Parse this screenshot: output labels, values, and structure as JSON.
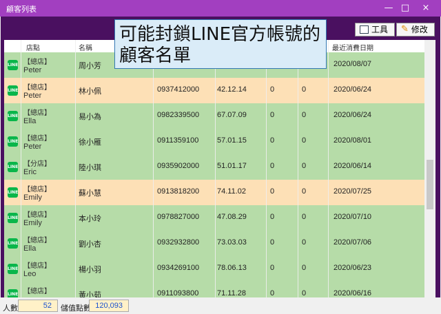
{
  "window": {
    "title": "顧客列表",
    "minimize": "—",
    "maximize": "□",
    "close": "×"
  },
  "toolbar": {
    "tools": "工具",
    "edit": "修改"
  },
  "callout": {
    "text": "可能封鎖LINE官方帳號的顧客名單"
  },
  "columns": {
    "store": "店點",
    "name": "名稱",
    "last_date": "最近消費日期"
  },
  "colors": {
    "green": "#b6dca8",
    "orange": "#fde0b6",
    "line": "#09b64a",
    "title": "#a23fc0"
  },
  "rows": [
    {
      "store": "【總店】",
      "staff": "Peter",
      "name": "周小芳",
      "phone": "",
      "birthday": "",
      "a": "",
      "b": "",
      "last": "2020/08/07",
      "tone": "green"
    },
    {
      "store": "【總店】",
      "staff": "Peter",
      "name": "林小佩",
      "phone": "0937412000",
      "birthday": "42.12.14",
      "a": "0",
      "b": "0",
      "last": "2020/06/24",
      "tone": "orange"
    },
    {
      "store": "【總店】",
      "staff": "Ella",
      "name": "易小為",
      "phone": "0982339500",
      "birthday": "67.07.09",
      "a": "0",
      "b": "0",
      "last": "2020/06/24",
      "tone": "green"
    },
    {
      "store": "【總店】",
      "staff": "Peter",
      "name": "徐小雁",
      "phone": "0911359100",
      "birthday": "57.01.15",
      "a": "0",
      "b": "0",
      "last": "2020/08/01",
      "tone": "green"
    },
    {
      "store": "【分店】",
      "staff": "Eric",
      "name": "陸小琪",
      "phone": "0935902000",
      "birthday": "51.01.17",
      "a": "0",
      "b": "0",
      "last": "2020/06/14",
      "tone": "green"
    },
    {
      "store": "【總店】",
      "staff": "Emily",
      "name": "蘇小慧",
      "phone": "0913818200",
      "birthday": "74.11.02",
      "a": "0",
      "b": "0",
      "last": "2020/07/25",
      "tone": "orange"
    },
    {
      "store": "【總店】",
      "staff": "Emily",
      "name": "本小玲",
      "phone": "0978827000",
      "birthday": "47.08.29",
      "a": "0",
      "b": "0",
      "last": "2020/07/10",
      "tone": "green"
    },
    {
      "store": "【總店】",
      "staff": "Ella",
      "name": "劉小杏",
      "phone": "0932932800",
      "birthday": "73.03.03",
      "a": "0",
      "b": "0",
      "last": "2020/07/06",
      "tone": "green"
    },
    {
      "store": "【總店】",
      "staff": "Leo",
      "name": "楊小羽",
      "phone": "0934269100",
      "birthday": "78.06.13",
      "a": "0",
      "b": "0",
      "last": "2020/06/23",
      "tone": "green"
    },
    {
      "store": "【總店】",
      "staff": "",
      "name": "黃小茹",
      "phone": "0911093800",
      "birthday": "71.11.28",
      "a": "0",
      "b": "0",
      "last": "2020/06/16",
      "tone": "green"
    }
  ],
  "status": {
    "count_label": "人數",
    "count": "52",
    "points_label": "儲值點數",
    "points": "120,093"
  }
}
